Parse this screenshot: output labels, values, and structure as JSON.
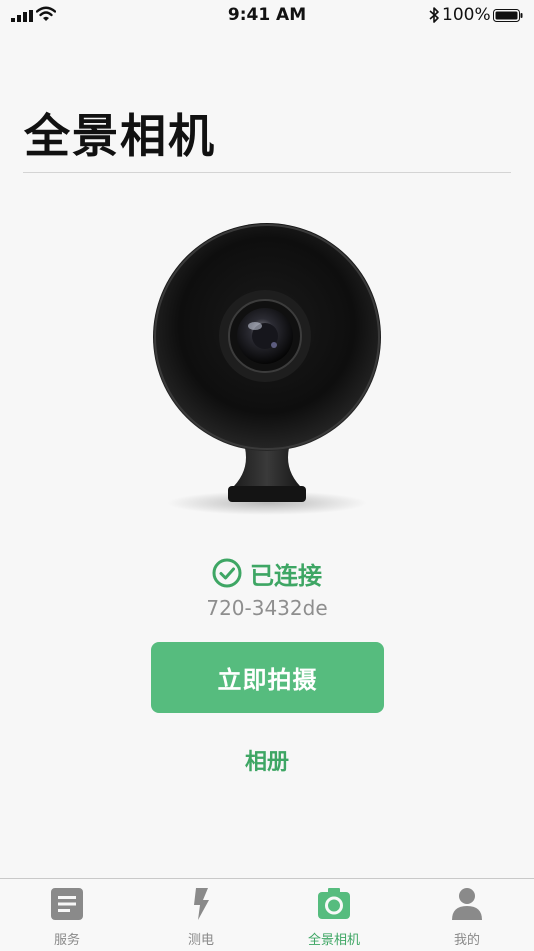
{
  "status_bar": {
    "time": "9:41 AM",
    "battery": "100%"
  },
  "page": {
    "title": "全景相机"
  },
  "connection": {
    "status": "已连接",
    "device_id": "720-3432de"
  },
  "actions": {
    "shoot_label": "立即拍摄",
    "album_label": "相册"
  },
  "tabs": [
    {
      "label": "服务",
      "icon": "service-doc-icon",
      "active": false
    },
    {
      "label": "测电",
      "icon": "lightning-icon",
      "active": false
    },
    {
      "label": "全景相机",
      "icon": "camera-icon",
      "active": true
    },
    {
      "label": "我的",
      "icon": "person-icon",
      "active": false
    }
  ],
  "colors": {
    "accent": "#56bc7e",
    "accent_text": "#3ea664",
    "inactive": "#8a8a8a"
  }
}
